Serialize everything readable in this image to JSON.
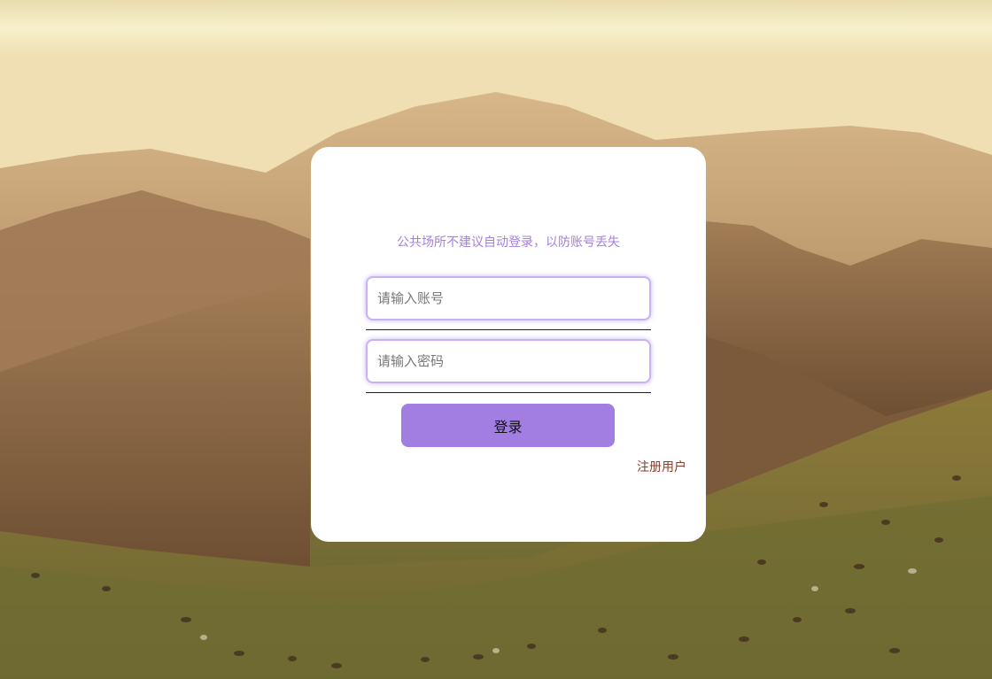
{
  "login": {
    "notice": "公共场所不建议自动登录，以防账号丢失",
    "account_placeholder": "请输入账号",
    "account_value": "",
    "password_placeholder": "请输入密码",
    "password_value": "",
    "login_label": "登录",
    "register_label": "注册用户"
  },
  "colors": {
    "accent": "#a27de2",
    "notice_text": "#a47fe0",
    "input_border": "#c7b2f2",
    "register_link": "#8a3e2c",
    "card_background": "#ffffff"
  }
}
